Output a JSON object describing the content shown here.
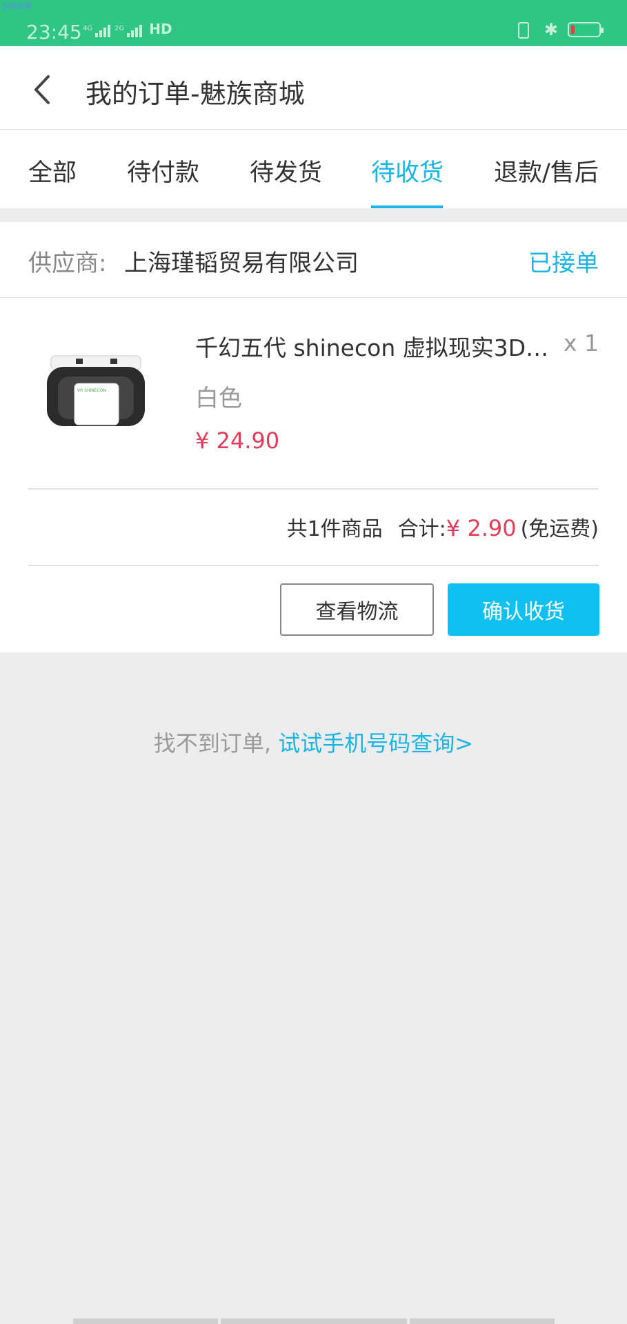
{
  "status_bar": {
    "tiny_label": "当前运营",
    "time": "23:45",
    "net1": "4G",
    "net2": "2G",
    "hd": "HD"
  },
  "header": {
    "title": "我的订单-魅族商城"
  },
  "tabs": [
    {
      "label": "全部"
    },
    {
      "label": "待付款"
    },
    {
      "label": "待发货"
    },
    {
      "label": "待收货"
    },
    {
      "label": "退款/售后"
    }
  ],
  "active_tab": 3,
  "order": {
    "supplier_label": "供应商:",
    "supplier_name": "上海瑾韬贸易有限公司",
    "status": "已接单",
    "product": {
      "name": "千幻五代 shinecon 虚拟现实3D…",
      "qty": "x 1",
      "spec": "白色",
      "price": "¥ 24.90",
      "image_label": "VR SHINECON"
    },
    "summary": {
      "count_text": "共1件商品",
      "total_label": "合计:",
      "total_value": "¥ 2.90",
      "shipping_note": "(免运费)"
    },
    "buttons": {
      "logistics": "查看物流",
      "confirm": "确认收货"
    }
  },
  "hint": {
    "prefix": "找不到订单,",
    "link": "试试手机号码查询>"
  },
  "colors": {
    "status_bar": "#2ec585",
    "accent": "#1ab5e6",
    "price": "#e23c5a",
    "confirm_button": "#10c0f0"
  }
}
